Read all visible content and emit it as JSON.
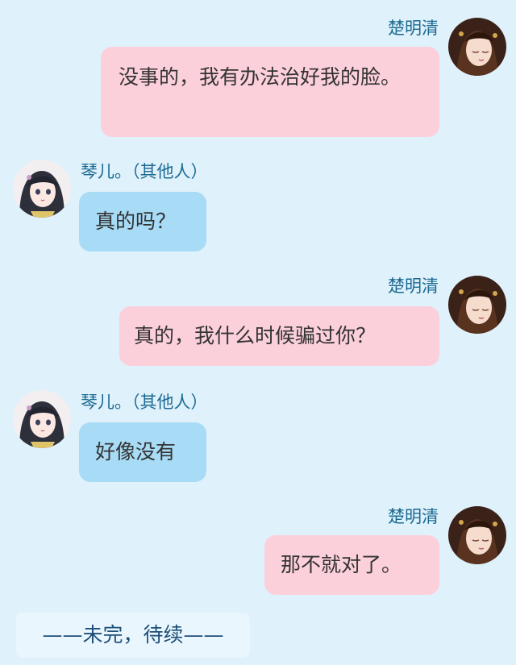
{
  "messages": [
    {
      "side": "right",
      "speaker": "楚明清",
      "text": "没事的，我有办法治好我的脸。"
    },
    {
      "side": "left",
      "speaker": "琴儿。（其他人）",
      "text": "真的吗？"
    },
    {
      "side": "right",
      "speaker": "楚明清",
      "text": "真的，我什么时候骗过你？"
    },
    {
      "side": "left",
      "speaker": "琴儿。（其他人）",
      "text": "好像没有"
    },
    {
      "side": "right",
      "speaker": "楚明清",
      "text": "那不就对了。"
    }
  ],
  "ending_text": "——未完，待续——",
  "colors": {
    "background": "#dff1fb",
    "right_bubble": "#fcd0db",
    "left_bubble": "#a8dbf6",
    "name": "#1b6a92"
  }
}
